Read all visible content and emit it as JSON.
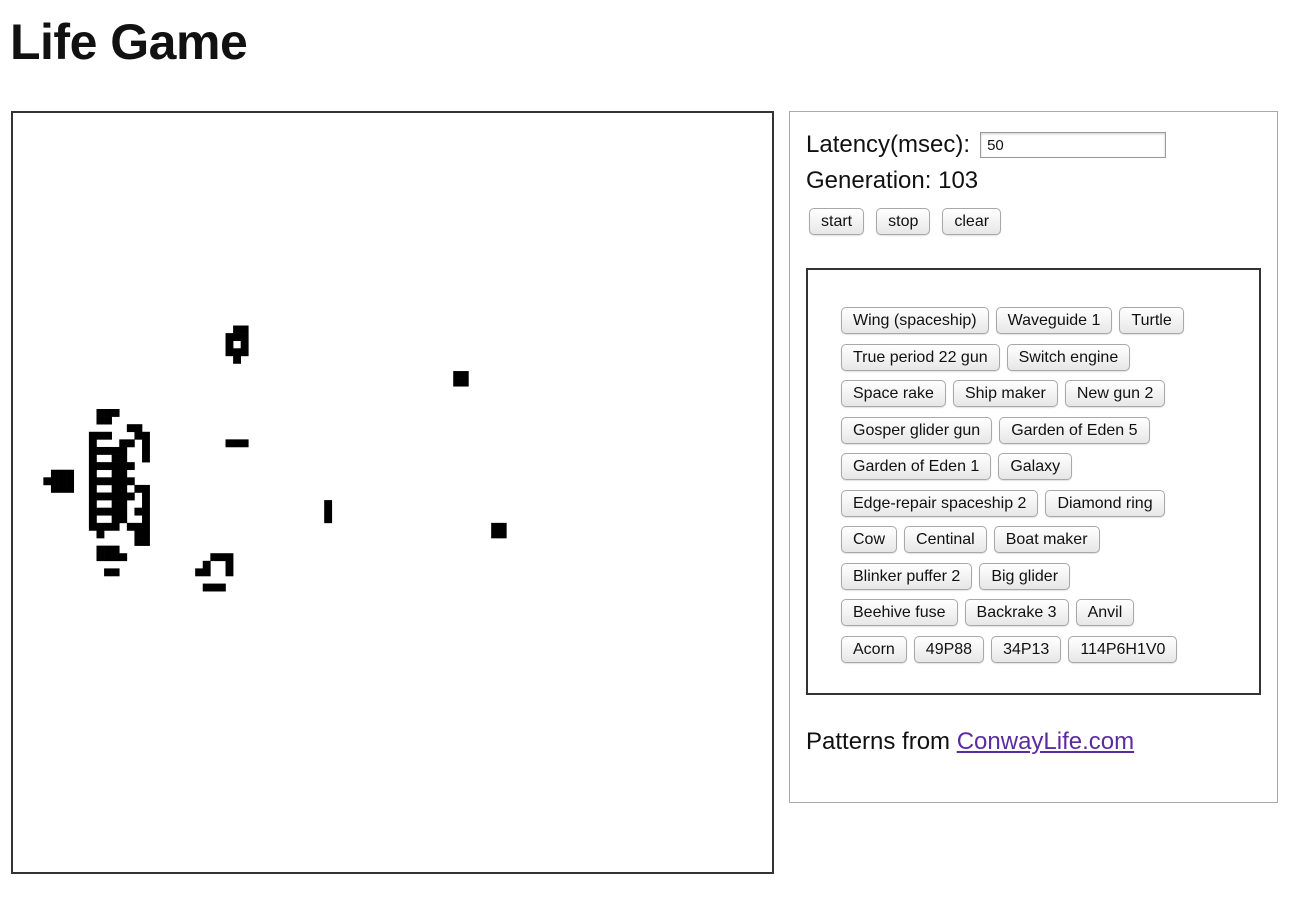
{
  "page": {
    "title": "Life Game"
  },
  "board": {
    "cell_color": "#000000",
    "background": "#ffffff",
    "grid_size": 100,
    "live_cells": [
      [
        29,
        28
      ],
      [
        30,
        28
      ],
      [
        28,
        29
      ],
      [
        29,
        29
      ],
      [
        30,
        29
      ],
      [
        28,
        30
      ],
      [
        30,
        30
      ],
      [
        28,
        31
      ],
      [
        29,
        31
      ],
      [
        30,
        31
      ],
      [
        29,
        32
      ],
      [
        58,
        34
      ],
      [
        59,
        34
      ],
      [
        58,
        35
      ],
      [
        59,
        35
      ],
      [
        11,
        39
      ],
      [
        12,
        39
      ],
      [
        13,
        39
      ],
      [
        11,
        40
      ],
      [
        12,
        40
      ],
      [
        15,
        41
      ],
      [
        16,
        41
      ],
      [
        10,
        42
      ],
      [
        11,
        42
      ],
      [
        12,
        42
      ],
      [
        16,
        42
      ],
      [
        17,
        42
      ],
      [
        10,
        43
      ],
      [
        14,
        43
      ],
      [
        15,
        43
      ],
      [
        17,
        43
      ],
      [
        28,
        43
      ],
      [
        29,
        43
      ],
      [
        30,
        43
      ],
      [
        10,
        44
      ],
      [
        11,
        44
      ],
      [
        12,
        44
      ],
      [
        13,
        44
      ],
      [
        14,
        44
      ],
      [
        17,
        44
      ],
      [
        10,
        45
      ],
      [
        13,
        45
      ],
      [
        14,
        45
      ],
      [
        17,
        45
      ],
      [
        10,
        46
      ],
      [
        11,
        46
      ],
      [
        12,
        46
      ],
      [
        13,
        46
      ],
      [
        14,
        46
      ],
      [
        15,
        46
      ],
      [
        5,
        47
      ],
      [
        6,
        47
      ],
      [
        7,
        47
      ],
      [
        10,
        47
      ],
      [
        13,
        47
      ],
      [
        14,
        47
      ],
      [
        4,
        48
      ],
      [
        5,
        48
      ],
      [
        6,
        48
      ],
      [
        7,
        48
      ],
      [
        10,
        48
      ],
      [
        11,
        48
      ],
      [
        12,
        48
      ],
      [
        13,
        48
      ],
      [
        14,
        48
      ],
      [
        15,
        48
      ],
      [
        5,
        49
      ],
      [
        6,
        49
      ],
      [
        7,
        49
      ],
      [
        10,
        49
      ],
      [
        13,
        49
      ],
      [
        14,
        49
      ],
      [
        16,
        49
      ],
      [
        17,
        49
      ],
      [
        10,
        50
      ],
      [
        11,
        50
      ],
      [
        12,
        50
      ],
      [
        13,
        50
      ],
      [
        14,
        50
      ],
      [
        15,
        50
      ],
      [
        17,
        50
      ],
      [
        10,
        51
      ],
      [
        13,
        51
      ],
      [
        14,
        51
      ],
      [
        17,
        51
      ],
      [
        41,
        51
      ],
      [
        10,
        52
      ],
      [
        11,
        52
      ],
      [
        12,
        52
      ],
      [
        13,
        52
      ],
      [
        14,
        52
      ],
      [
        16,
        52
      ],
      [
        17,
        52
      ],
      [
        41,
        52
      ],
      [
        10,
        53
      ],
      [
        13,
        53
      ],
      [
        14,
        53
      ],
      [
        17,
        53
      ],
      [
        41,
        53
      ],
      [
        10,
        54
      ],
      [
        11,
        54
      ],
      [
        12,
        54
      ],
      [
        13,
        54
      ],
      [
        15,
        54
      ],
      [
        16,
        54
      ],
      [
        17,
        54
      ],
      [
        63,
        54
      ],
      [
        64,
        54
      ],
      [
        11,
        55
      ],
      [
        16,
        55
      ],
      [
        17,
        55
      ],
      [
        63,
        55
      ],
      [
        64,
        55
      ],
      [
        16,
        56
      ],
      [
        17,
        56
      ],
      [
        11,
        57
      ],
      [
        12,
        57
      ],
      [
        13,
        57
      ],
      [
        11,
        58
      ],
      [
        12,
        58
      ],
      [
        13,
        58
      ],
      [
        14,
        58
      ],
      [
        26,
        58
      ],
      [
        27,
        58
      ],
      [
        28,
        58
      ],
      [
        25,
        59
      ],
      [
        28,
        59
      ],
      [
        12,
        60
      ],
      [
        13,
        60
      ],
      [
        24,
        60
      ],
      [
        25,
        60
      ],
      [
        28,
        60
      ],
      [
        25,
        62
      ],
      [
        26,
        62
      ],
      [
        27,
        62
      ]
    ]
  },
  "controls": {
    "latency_label": "Latency(msec):",
    "latency_value": "50",
    "generation_label": "Generation:",
    "generation_value": "103",
    "start_label": "start",
    "stop_label": "stop",
    "clear_label": "clear"
  },
  "patterns": {
    "rows": [
      [
        "Wing (spaceship)",
        "Waveguide 1",
        "Turtle"
      ],
      [
        "True period 22 gun",
        "Switch engine"
      ],
      [
        "Space rake",
        "Ship maker",
        "New gun 2"
      ],
      [
        "Gosper glider gun",
        "Garden of Eden 5"
      ],
      [
        "Garden of Eden 1",
        "Galaxy"
      ],
      [
        "Edge-repair spaceship 2",
        "Diamond ring"
      ],
      [
        "Cow",
        "Centinal",
        "Boat maker"
      ],
      [
        "Blinker puffer 2",
        "Big glider"
      ],
      [
        "Beehive fuse",
        "Backrake 3",
        "Anvil"
      ],
      [
        "Acorn",
        "49P88",
        "34P13",
        "114P6H1V0"
      ]
    ]
  },
  "footer": {
    "prefix": "Patterns from",
    "link_text": "ConwayLife.com",
    "link_color": "#5b2ca0"
  }
}
